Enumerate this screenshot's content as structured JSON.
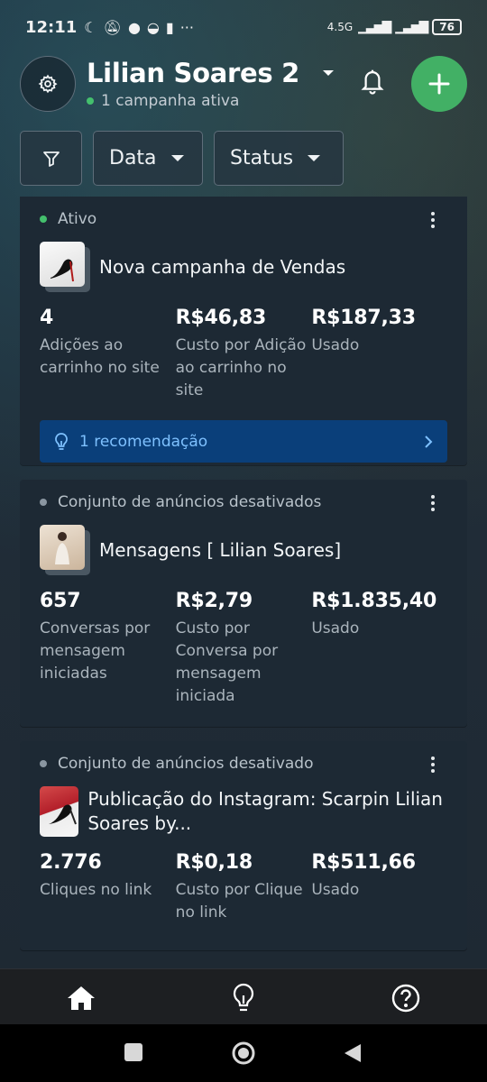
{
  "status_bar": {
    "time": "12:11",
    "network": "4.5G",
    "battery": "76"
  },
  "header": {
    "account_name": "Lilian Soares 2",
    "active_campaigns": "1 campanha ativa",
    "accent_color": "#42b065"
  },
  "filters": {
    "date_label": "Data",
    "status_label": "Status"
  },
  "campaigns": [
    {
      "status": "Ativo",
      "status_color": "#44c06d",
      "name": "Nova campanha de Vendas",
      "metrics": [
        {
          "value": "4",
          "label": "Adições ao carrinho no site"
        },
        {
          "value": "R$46,83",
          "label": "Custo por Adição ao carrinho no site"
        },
        {
          "value": "R$187,33",
          "label": "Usado"
        }
      ],
      "recommendation": "1 recomendação"
    },
    {
      "status": "Conjunto de anúncios desativados",
      "status_color": "#8a96a1",
      "name": "Mensagens [ Lilian Soares]",
      "metrics": [
        {
          "value": "657",
          "label": "Conversas por mensagem iniciadas"
        },
        {
          "value": "R$2,79",
          "label": "Custo por Conversa por mensagem iniciada"
        },
        {
          "value": "R$1.835,40",
          "label": "Usado"
        }
      ]
    },
    {
      "status": "Conjunto de anúncios desativado",
      "status_color": "#8a96a1",
      "name": "Publicação do Instagram: Scarpin Lilian Soares by...",
      "metrics": [
        {
          "value": "2.776",
          "label": "Cliques no link"
        },
        {
          "value": "R$0,18",
          "label": "Custo por Clique no link"
        },
        {
          "value": "R$511,66",
          "label": "Usado"
        }
      ]
    }
  ],
  "icons": {
    "settings": "gear-icon",
    "notifications": "bell-icon",
    "add": "plus-icon",
    "filter": "funnel-icon",
    "home": "home-icon",
    "recommendations": "lightbulb-icon",
    "help": "help-icon"
  }
}
